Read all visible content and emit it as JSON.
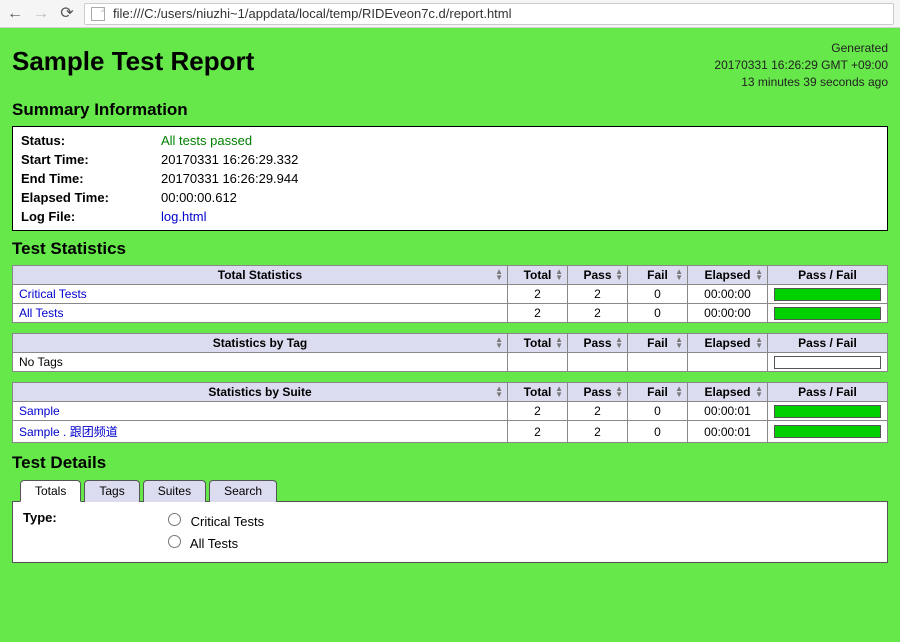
{
  "browser": {
    "url": "file:///C:/users/niuzhi~1/appdata/local/temp/RIDEveon7c.d/report.html"
  },
  "report": {
    "title": "Sample Test Report",
    "generated_label": "Generated",
    "generated_ts": "20170331 16:26:29 GMT +09:00",
    "generated_ago": "13 minutes 39 seconds ago"
  },
  "summary_heading": "Summary Information",
  "summary": {
    "status_label": "Status:",
    "status_value": "All tests passed",
    "start_label": "Start Time:",
    "start_value": "20170331 16:26:29.332",
    "end_label": "End Time:",
    "end_value": "20170331 16:26:29.944",
    "elapsed_label": "Elapsed Time:",
    "elapsed_value": "00:00:00.612",
    "log_label": "Log File:",
    "log_value": "log.html"
  },
  "stats_heading": "Test Statistics",
  "stats_cols": {
    "total": "Total",
    "pass": "Pass",
    "fail": "Fail",
    "elapsed": "Elapsed",
    "pf": "Pass / Fail"
  },
  "total_stats": {
    "header": "Total Statistics",
    "rows": [
      {
        "name": "Critical Tests",
        "total": "2",
        "pass": "2",
        "fail": "0",
        "elapsed": "00:00:00"
      },
      {
        "name": "All Tests",
        "total": "2",
        "pass": "2",
        "fail": "0",
        "elapsed": "00:00:00"
      }
    ]
  },
  "tag_stats": {
    "header": "Statistics by Tag",
    "empty_label": "No Tags"
  },
  "suite_stats": {
    "header": "Statistics by Suite",
    "rows": [
      {
        "name": "Sample",
        "total": "2",
        "pass": "2",
        "fail": "0",
        "elapsed": "00:00:01"
      },
      {
        "name": "Sample . 跟团频道",
        "total": "2",
        "pass": "2",
        "fail": "0",
        "elapsed": "00:00:01"
      }
    ]
  },
  "details_heading": "Test Details",
  "tabs": {
    "totals": "Totals",
    "tags": "Tags",
    "suites": "Suites",
    "search": "Search"
  },
  "totals_panel": {
    "type_label": "Type:",
    "opt_critical": "Critical Tests",
    "opt_all": "All Tests"
  }
}
